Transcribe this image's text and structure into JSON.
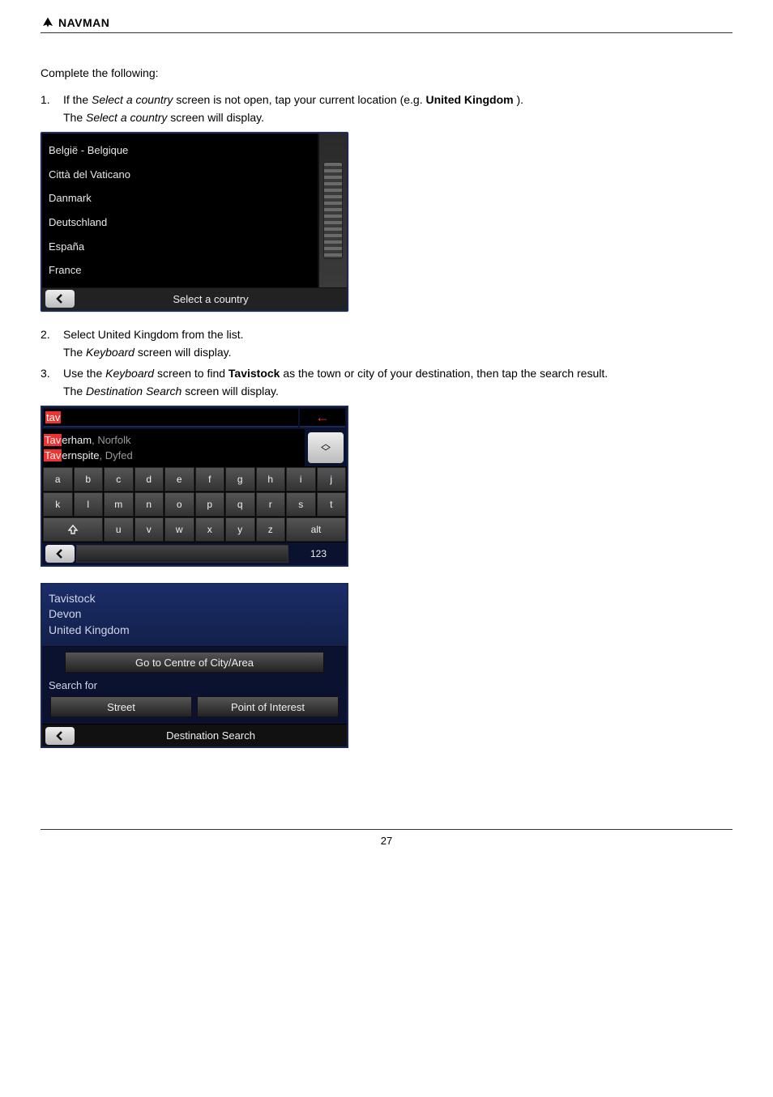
{
  "brand": "NAVMAN",
  "intro": "Complete the following:",
  "step1": {
    "num": "1.",
    "text_a": "If the ",
    "text_b": " screen is not open, tap your current location (e.g. ",
    "text_c": ").",
    "text_d": " screen will display.",
    "em_select_country": "Select a country",
    "em_uk": "United Kingdom",
    "em_the": "The "
  },
  "screen1": {
    "countries": [
      "België - Belgique",
      "Città del Vaticano",
      "Danmark",
      "Deutschland",
      "España",
      "France"
    ],
    "footer": "Select a country"
  },
  "step2": {
    "num": "2.",
    "text": "Select United Kingdom from the list.",
    "sub_a": "The ",
    "sub_b": "Keyboard",
    "sub_c": " screen will display."
  },
  "step3": {
    "num": "3.",
    "text_a": "Use the ",
    "text_b": "Keyboard",
    "text_c": " screen to find ",
    "text_d": "Tavistock",
    "text_e": " as the town or city of your destination, then tap the search result.",
    "sub_a": "The ",
    "sub_b": "Destination Search",
    "sub_c": " screen will display."
  },
  "screen2": {
    "typed": "tav",
    "results": [
      {
        "match": "Tav",
        "rest": "erham",
        "suffix": ", Norfolk"
      },
      {
        "match": "Tav",
        "rest": "ernspite",
        "suffix": ", Dyfed"
      }
    ],
    "row1": [
      "a",
      "b",
      "c",
      "d",
      "e",
      "f",
      "g",
      "h",
      "i",
      "j"
    ],
    "row2": [
      "k",
      "l",
      "m",
      "n",
      "o",
      "p",
      "q",
      "r",
      "s",
      "t"
    ],
    "row3": [
      "u",
      "v",
      "w",
      "x",
      "y",
      "z"
    ],
    "alt": "alt",
    "num": "123"
  },
  "screen3": {
    "city": "Tavistock",
    "region": "Devon",
    "country": "United Kingdom",
    "go_centre": "Go to Centre of City/Area",
    "search_for": "Search for",
    "street": "Street",
    "poi": "Point of Interest",
    "footer": "Destination Search"
  },
  "page_number": "27"
}
